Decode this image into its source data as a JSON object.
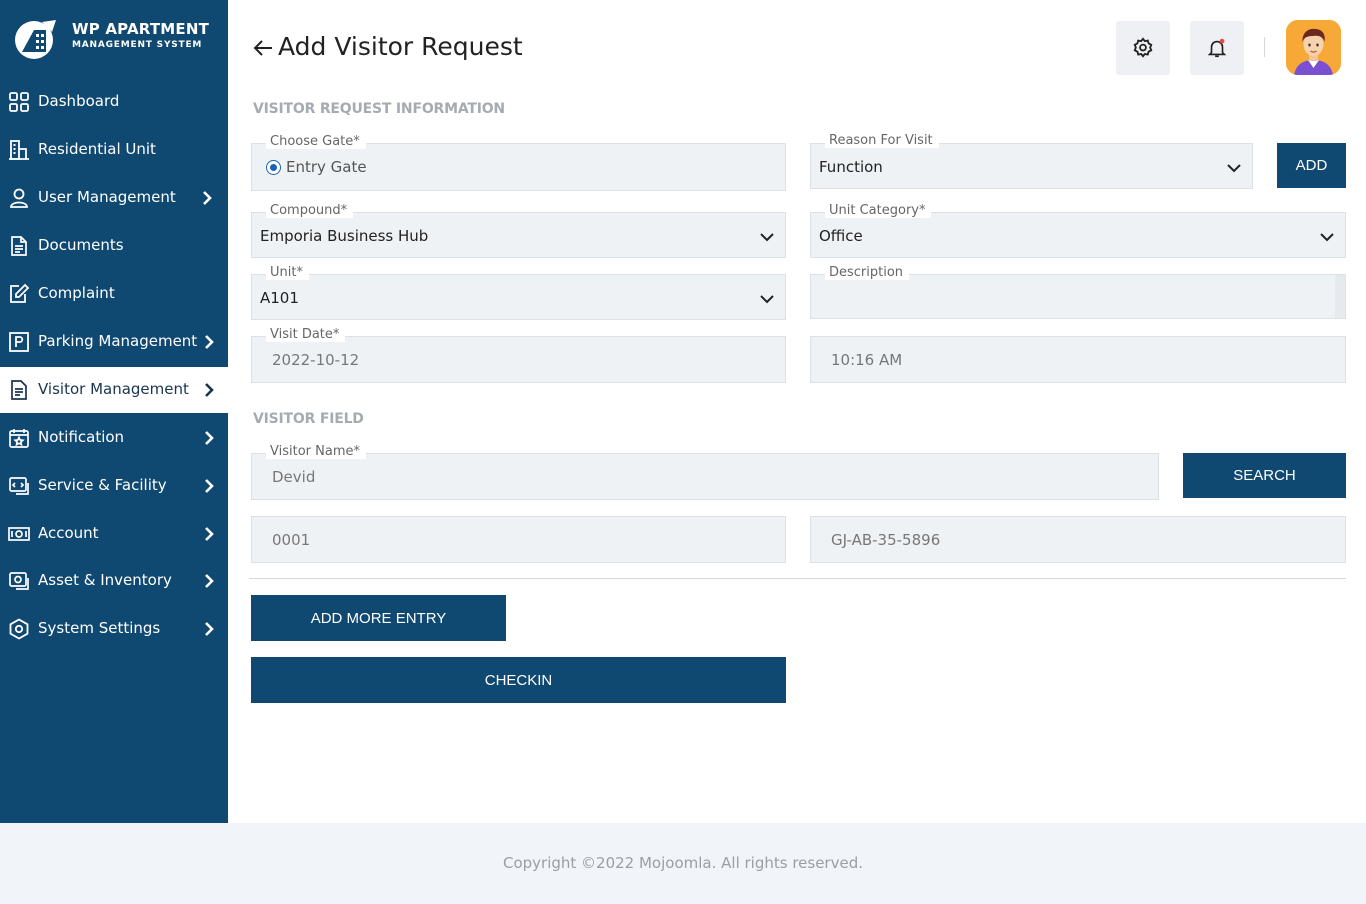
{
  "brand": {
    "title": "WP APARTMENT",
    "subtitle": "MANAGEMENT SYSTEM",
    "accent": "#0f4870"
  },
  "sidebar": {
    "items": [
      {
        "label": "Dashboard",
        "icon": "grid-icon",
        "has_submenu": false,
        "active": false
      },
      {
        "label": "Residential Unit",
        "icon": "building-icon",
        "has_submenu": false,
        "active": false
      },
      {
        "label": "User Management",
        "icon": "user-icon",
        "has_submenu": true,
        "active": false
      },
      {
        "label": "Documents",
        "icon": "document-icon",
        "has_submenu": false,
        "active": false
      },
      {
        "label": "Complaint",
        "icon": "edit-icon",
        "has_submenu": false,
        "active": false
      },
      {
        "label": "Parking Management",
        "icon": "parking-icon",
        "has_submenu": true,
        "active": false
      },
      {
        "label": "Visitor Management",
        "icon": "clipboard-icon",
        "has_submenu": true,
        "active": true
      },
      {
        "label": "Notification",
        "icon": "calendar-star-icon",
        "has_submenu": true,
        "active": false
      },
      {
        "label": "Service & Facility",
        "icon": "service-icon",
        "has_submenu": true,
        "active": false
      },
      {
        "label": "Account",
        "icon": "money-icon",
        "has_submenu": true,
        "active": false
      },
      {
        "label": "Asset & Inventory",
        "icon": "inventory-icon",
        "has_submenu": true,
        "active": false
      },
      {
        "label": "System Settings",
        "icon": "hexagon-gear-icon",
        "has_submenu": true,
        "active": false
      }
    ]
  },
  "header": {
    "title": "Add Visitor Request",
    "settings_icon": "gear-icon",
    "notification_icon": "bell-icon",
    "notification_dot_color": "#e74c3c"
  },
  "sections": {
    "request_info": "VISITOR REQUEST INFORMATION",
    "visitor_field": "VISITOR FIELD"
  },
  "form": {
    "gate": {
      "label": "Choose Gate*",
      "option": "Entry Gate",
      "selected": true
    },
    "reason": {
      "label": "Reason For Visit",
      "value": "Function"
    },
    "add_button": "ADD",
    "compound": {
      "label": "Compound*",
      "value": "Emporia Business Hub"
    },
    "unit_category": {
      "label": "Unit Category*",
      "value": "Office"
    },
    "unit": {
      "label": "Unit*",
      "value": "A101"
    },
    "description": {
      "label": "Description",
      "value": ""
    },
    "visit_date": {
      "label": "Visit Date*",
      "value": "2022-10-12"
    },
    "visit_time": {
      "value": "10:16 AM"
    }
  },
  "visitor": {
    "name": {
      "label": "Visitor Name*",
      "value": "Devid"
    },
    "search_button": "SEARCH",
    "id_field": "0001",
    "vehicle_field": "GJ-AB-35-5896",
    "add_more_button": "ADD MORE ENTRY",
    "checkin_button": "CHECKIN"
  },
  "footer": {
    "copyright": "Copyright ©2022 Mojoomla. All rights reserved."
  }
}
